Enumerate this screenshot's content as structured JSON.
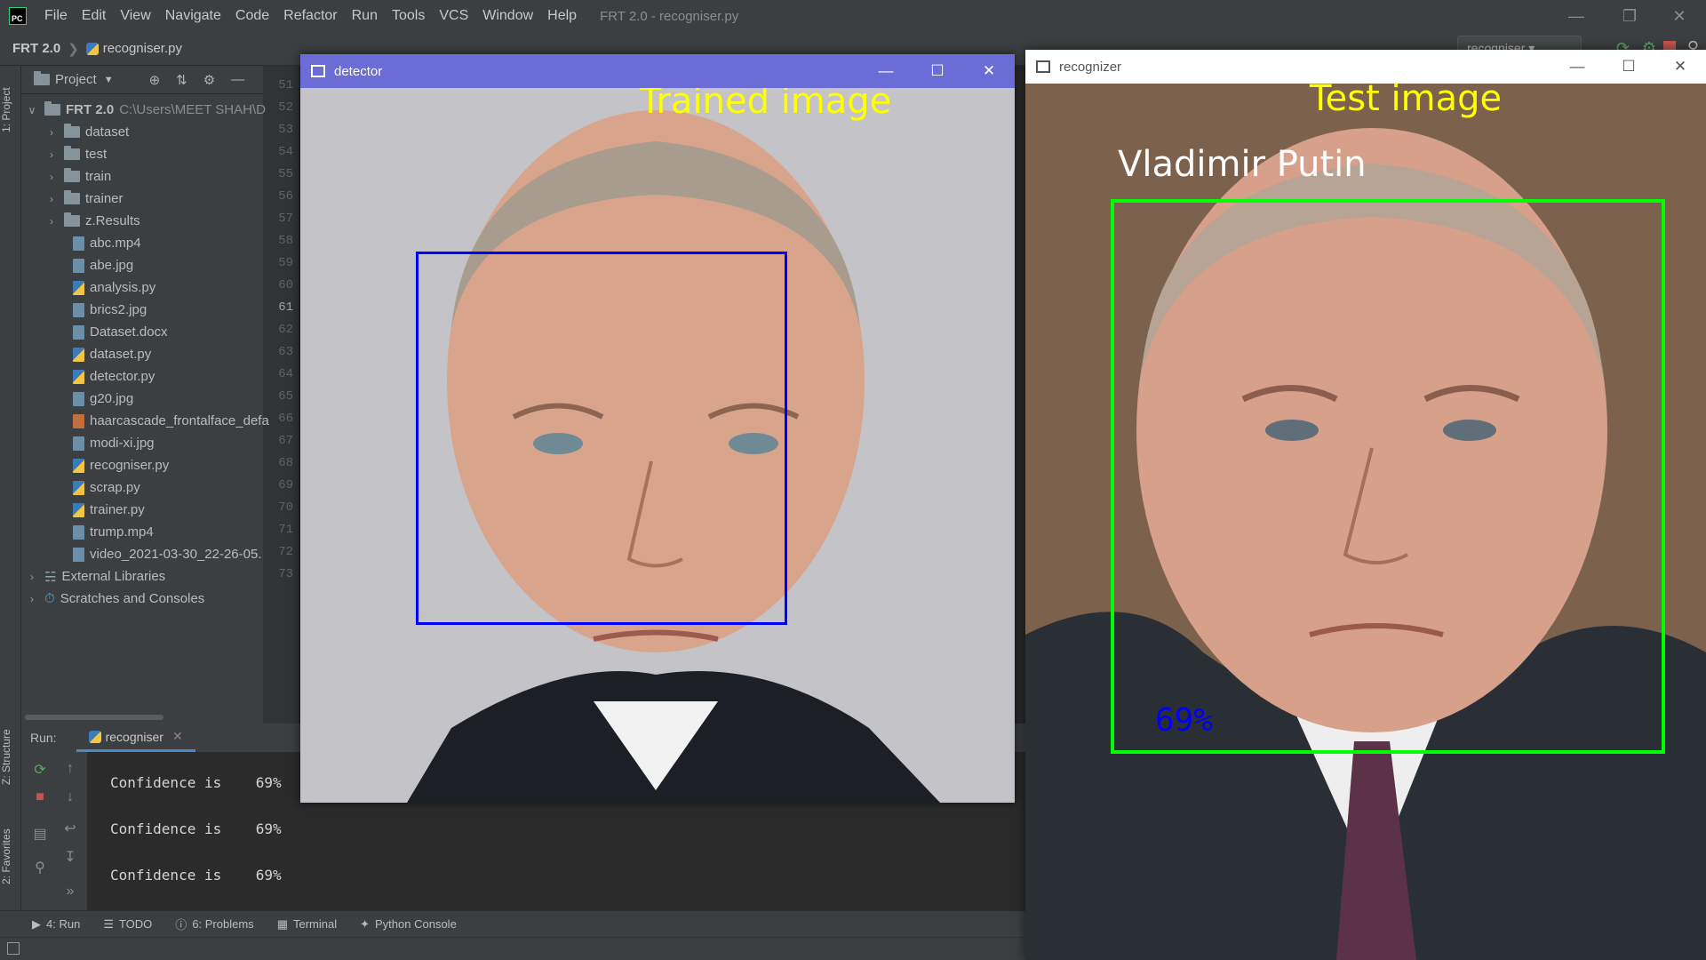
{
  "app": {
    "window_title": "FRT 2.0 - recogniser.py",
    "menu": [
      "File",
      "Edit",
      "View",
      "Navigate",
      "Code",
      "Refactor",
      "Run",
      "Tools",
      "VCS",
      "Window",
      "Help"
    ]
  },
  "navbar": {
    "project": "FRT 2.0",
    "file": "recogniser.py",
    "run_config": "recogniser"
  },
  "project_panel": {
    "title": "Project",
    "root": {
      "name": "FRT 2.0",
      "path": "C:\\Users\\MEET SHAH\\D"
    },
    "items": [
      {
        "name": "dataset",
        "kind": "folder"
      },
      {
        "name": "test",
        "kind": "folder"
      },
      {
        "name": "train",
        "kind": "folder"
      },
      {
        "name": "trainer",
        "kind": "folder"
      },
      {
        "name": "z.Results",
        "kind": "folder"
      },
      {
        "name": "abc.mp4",
        "kind": "file"
      },
      {
        "name": "abe.jpg",
        "kind": "file"
      },
      {
        "name": "analysis.py",
        "kind": "py"
      },
      {
        "name": "brics2.jpg",
        "kind": "file"
      },
      {
        "name": "Dataset.docx",
        "kind": "file"
      },
      {
        "name": "dataset.py",
        "kind": "py"
      },
      {
        "name": "detector.py",
        "kind": "py"
      },
      {
        "name": "g20.jpg",
        "kind": "file"
      },
      {
        "name": "haarcascade_frontalface_defa",
        "kind": "xml"
      },
      {
        "name": "modi-xi.jpg",
        "kind": "file"
      },
      {
        "name": "recogniser.py",
        "kind": "py"
      },
      {
        "name": "scrap.py",
        "kind": "py"
      },
      {
        "name": "trainer.py",
        "kind": "py"
      },
      {
        "name": "trump.mp4",
        "kind": "file"
      },
      {
        "name": "video_2021-03-30_22-26-05.",
        "kind": "file"
      }
    ],
    "external": "External Libraries",
    "scratches": "Scratches and Consoles"
  },
  "gutter": [
    "51",
    "52",
    "53",
    "54",
    "55",
    "56",
    "57",
    "58",
    "59",
    "60",
    "61",
    "62",
    "63",
    "64",
    "65",
    "66",
    "67",
    "68",
    "69",
    "70",
    "71",
    "72",
    "73"
  ],
  "side_tabs": {
    "project": "1: Project",
    "structure": "Z: Structure",
    "favorites": "2: Favorites"
  },
  "run_panel": {
    "label": "Run:",
    "tab": "recogniser",
    "lines": [
      "Confidence is    69%",
      "Confidence is    69%",
      "Confidence is    69%"
    ]
  },
  "bottom_tabs": [
    "4: Run",
    "TODO",
    "6: Problems",
    "Terminal",
    "Python Console"
  ],
  "detector_window": {
    "title": "detector",
    "overlay": "Trained image"
  },
  "recognizer_window": {
    "title": "recognizer",
    "overlay": "Test image",
    "name_label": "Vladimir Putin",
    "confidence": "69%"
  },
  "colors": {
    "ide_bg": "#3c3f41",
    "editor_bg": "#2b2b2b",
    "detector_title": "#6b6cd6",
    "overlay_text": "#ffff00",
    "detect_box": "#0000ff",
    "recog_box": "#00ff00"
  }
}
